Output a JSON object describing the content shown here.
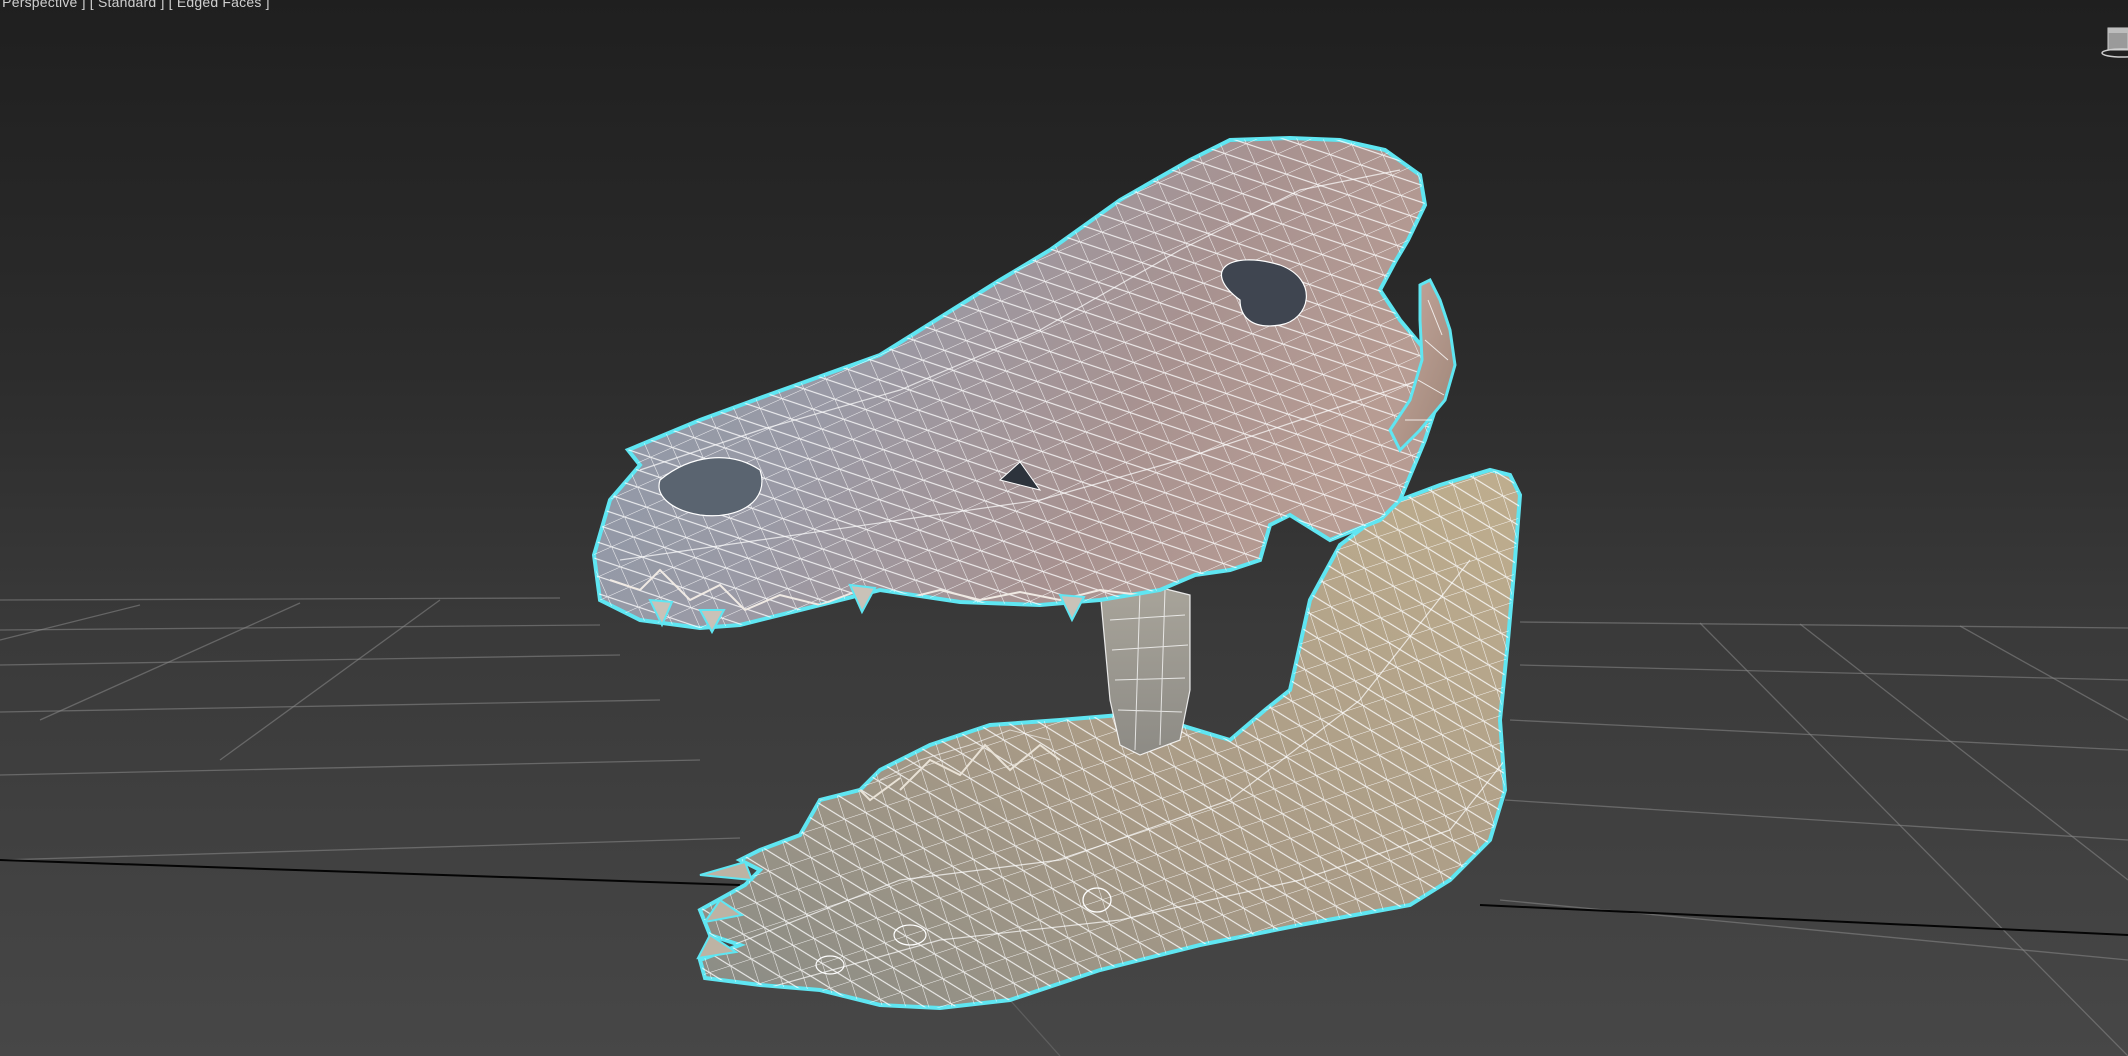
{
  "viewport": {
    "label_view": "[ Perspective ]",
    "label_shading": "[ Standard ]",
    "label_style": "[ Edged Faces ]"
  },
  "scene": {
    "object": "skull",
    "selection_outline_color": "#5fe6f2",
    "wireframe_color": "#ffffff",
    "grid_color": "#7a7a7a",
    "background_top": "#1f1f1f",
    "background_bottom": "#474747"
  },
  "icons": {
    "viewcube": "viewcube-icon"
  }
}
